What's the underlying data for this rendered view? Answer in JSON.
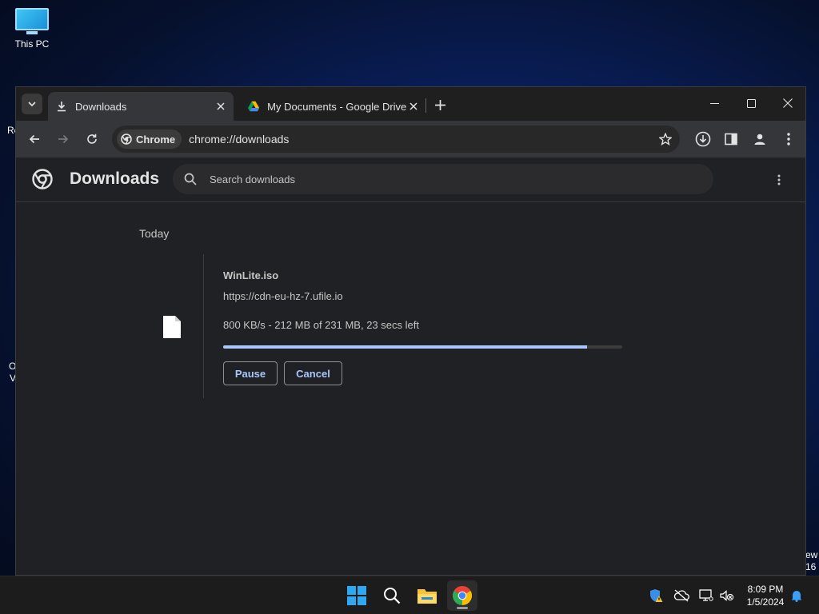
{
  "desktop": {
    "this_pc_label": "This PC",
    "edge_frag_1": "Re",
    "edge_frag_2": "O",
    "edge_frag_3": "V",
    "right_frag_1": "ew",
    "right_frag_2": "16"
  },
  "browser": {
    "tabs": [
      {
        "title": "Downloads",
        "icon": "download-icon",
        "active": true
      },
      {
        "title": "My Documents - Google Drive",
        "icon": "google-drive-icon",
        "active": false
      }
    ],
    "omnibox": {
      "chip_label": "Chrome",
      "url": "chrome://downloads"
    }
  },
  "downloads_page": {
    "title": "Downloads",
    "search_placeholder": "Search downloads",
    "date_group": "Today",
    "items": [
      {
        "file_name": "WinLite.iso",
        "source_url": "https://cdn-eu-hz-7.ufile.io",
        "status": "800 KB/s - 212 MB of 231 MB, 23 secs left",
        "progress_fraction": 0.912,
        "pause_label": "Pause",
        "cancel_label": "Cancel"
      }
    ]
  },
  "taskbar": {
    "apps": [
      "windows-start-icon",
      "search-icon",
      "file-explorer-icon",
      "chrome-icon"
    ],
    "time": "8:09 PM",
    "date": "1/5/2024"
  },
  "colors": {
    "accent": "#a8c7fa",
    "page_bg": "#202124",
    "toolbar_bg": "#35363a"
  }
}
